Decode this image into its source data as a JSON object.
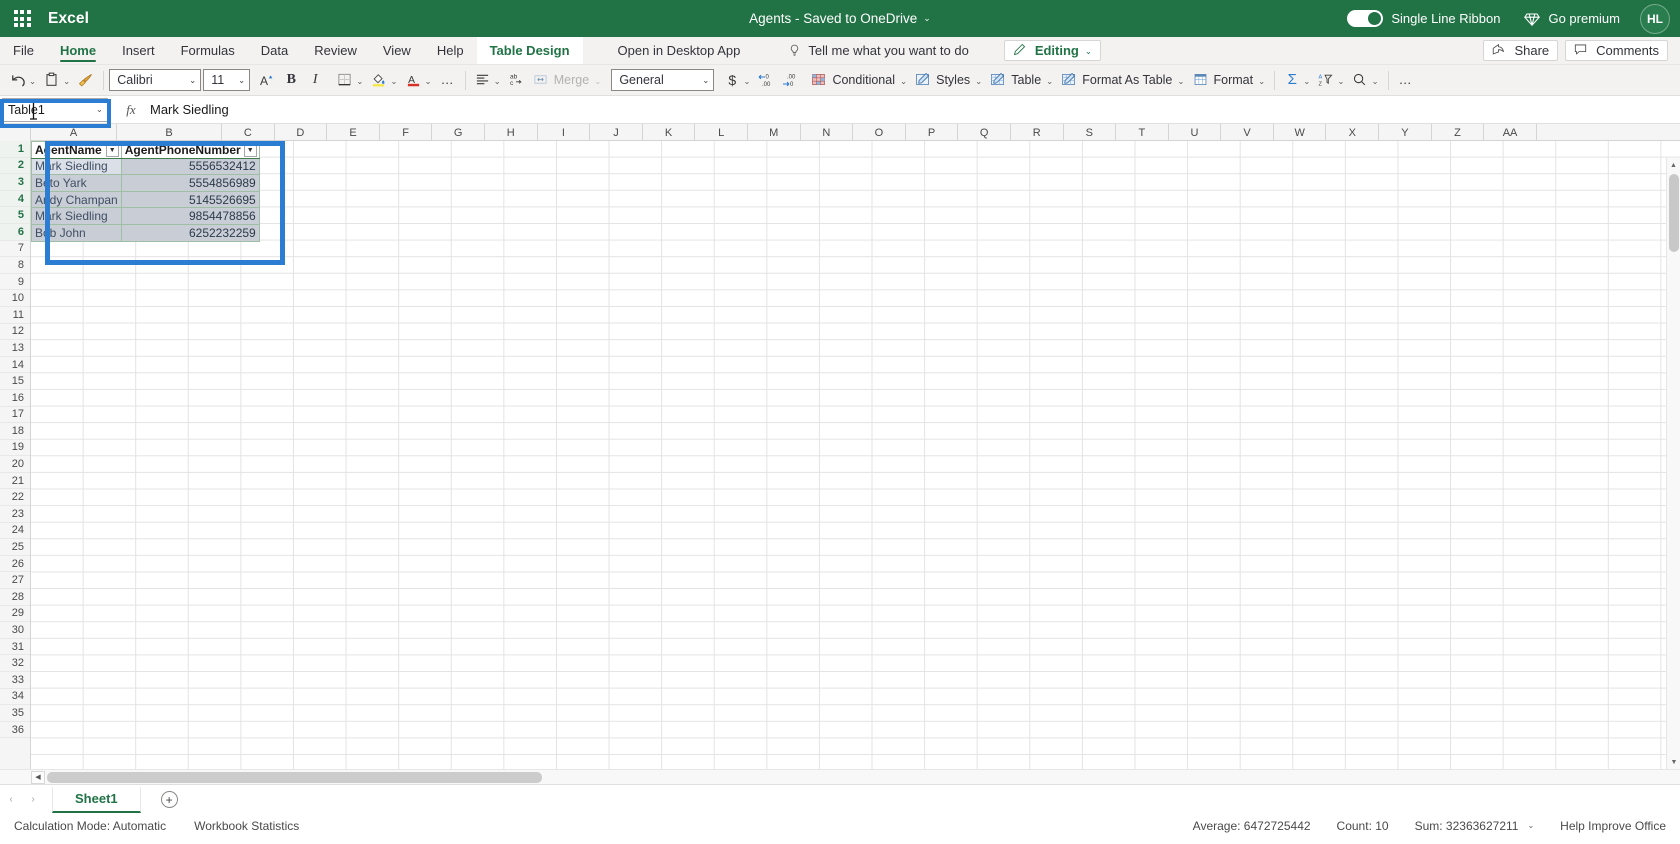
{
  "topbar": {
    "waffle_label": "app-launcher",
    "brand": "Excel",
    "doc_title": "Agents  -  Saved to OneDrive",
    "doc_title_chevron": "⌄",
    "ribbon_toggle_label": "Single Line Ribbon",
    "go_premium_label": "Go premium",
    "avatar_initials": "HL"
  },
  "tabs": [
    {
      "label": "File",
      "state": "normal"
    },
    {
      "label": "Home",
      "state": "active"
    },
    {
      "label": "Insert",
      "state": "normal"
    },
    {
      "label": "Formulas",
      "state": "normal"
    },
    {
      "label": "Data",
      "state": "normal"
    },
    {
      "label": "Review",
      "state": "normal"
    },
    {
      "label": "View",
      "state": "normal"
    },
    {
      "label": "Help",
      "state": "normal"
    },
    {
      "label": "Table Design",
      "state": "contextual"
    }
  ],
  "tabstrip": {
    "open_desktop": "Open in Desktop App",
    "tell_me": "Tell me what you want to do",
    "editing_label": "Editing",
    "editing_chevron": "⌄",
    "share_label": "Share",
    "comments_label": "Comments"
  },
  "ribbon": {
    "undo_label": "undo",
    "paste_label": "paste",
    "format_painter_label": "format-painter",
    "font_name": "Calibri",
    "font_size": "11",
    "font_grow_label": "A",
    "bold_label": "B",
    "italic_label": "I",
    "borders_label": "borders",
    "fill_color_label": "fill-color",
    "font_color_label": "A",
    "more_font_label": "…",
    "align_label": "alignment",
    "wrap_label": "wrap-text",
    "merge_label": "Merge",
    "number_format": "General",
    "currency_label": "$",
    "dec_increase_label": "increase-decimal",
    "dec_decrease_label": "decrease-decimal",
    "conditional_label": "Conditional",
    "styles_label": "Styles",
    "table_label": "Table",
    "format_as_table_label": "Format As Table",
    "format_label": "Format",
    "autosum_label": "Σ",
    "sort_filter_label": "sort-filter",
    "find_label": "find",
    "overflow_label": "…",
    "chevron": "⌄"
  },
  "formula_bar": {
    "name_box_value": "Table1",
    "name_box_chevron": "⌄",
    "fx_label": "fx",
    "formula_value": "Mark Siedling"
  },
  "grid": {
    "columns": [
      "A",
      "B",
      "C",
      "D",
      "E",
      "F",
      "G",
      "H",
      "I",
      "J",
      "K",
      "L",
      "M",
      "N",
      "O",
      "P",
      "Q",
      "R",
      "S",
      "T",
      "U",
      "V",
      "W",
      "X",
      "Y",
      "Z",
      "AA"
    ],
    "rows": [
      1,
      2,
      3,
      4,
      5,
      6,
      7,
      8,
      9,
      10,
      11,
      12,
      13,
      14,
      15,
      16,
      17,
      18,
      19,
      20,
      21,
      22,
      23,
      24,
      25,
      26,
      27,
      28,
      29,
      30,
      31,
      32,
      33,
      34,
      35,
      36
    ],
    "selected_rows": [
      1,
      2,
      3,
      4,
      5,
      6
    ],
    "accent_selection_color": "#2b7cd3"
  },
  "table": {
    "name": "Table1",
    "headers": [
      "AgentName",
      "AgentPhoneNumber"
    ],
    "filter_glyph": "▼",
    "rows": [
      {
        "AgentName": "Mark Siedling",
        "AgentPhoneNumber": "5556532412",
        "active": true
      },
      {
        "AgentName": "Beto Yark",
        "AgentPhoneNumber": "5554856989",
        "active": false
      },
      {
        "AgentName": "Andy Champan",
        "AgentPhoneNumber": "5145526695",
        "active": false
      },
      {
        "AgentName": "Mark Siedling",
        "AgentPhoneNumber": "9854478856",
        "active": false
      },
      {
        "AgentName": "Bob John",
        "AgentPhoneNumber": "6252232259",
        "active": false
      }
    ]
  },
  "sheetbar": {
    "prev_label": "‹",
    "next_label": "›",
    "sheets": [
      {
        "label": "Sheet1",
        "active": true
      }
    ],
    "add_sheet_label": "+"
  },
  "statusbar": {
    "calculation_mode": "Calculation Mode: Automatic",
    "workbook_statistics": "Workbook Statistics",
    "average": "Average: 6472725442",
    "count": "Count: 10",
    "sum": "Sum: 32363627211",
    "stats_chevron": "⌄",
    "help_improve": "Help Improve Office"
  }
}
